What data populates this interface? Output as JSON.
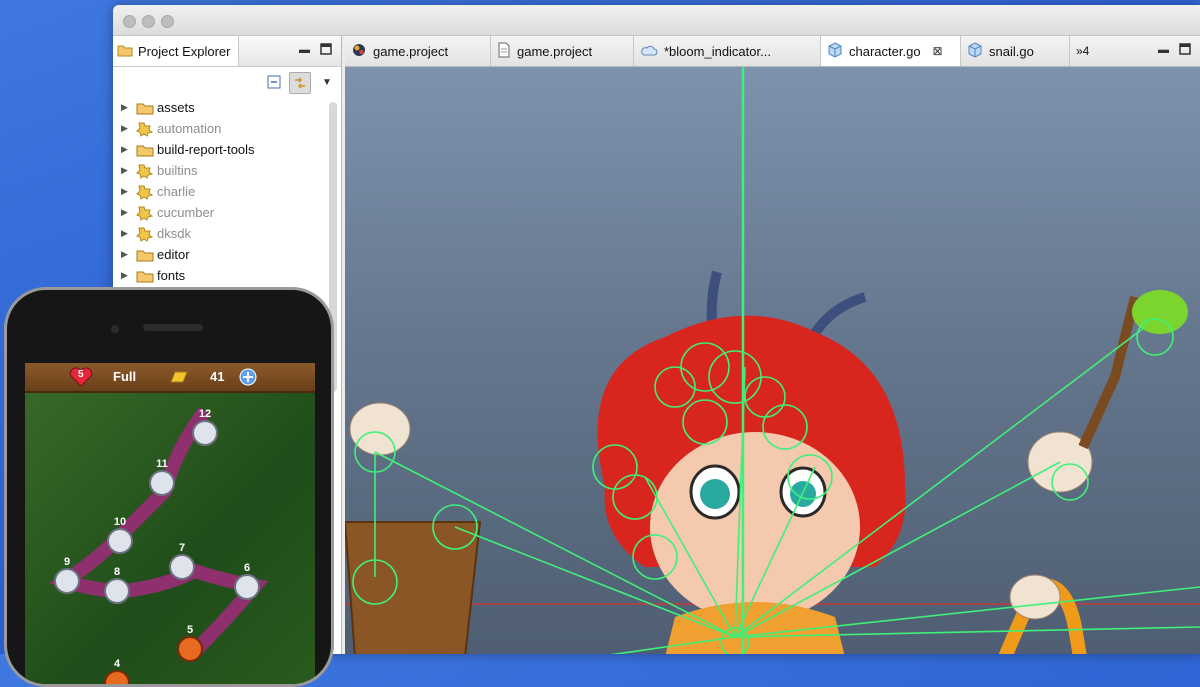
{
  "window": {
    "explorer": {
      "tab_label": "Project Explorer",
      "items": [
        {
          "label": "assets",
          "kind": "folder"
        },
        {
          "label": "automation",
          "kind": "library"
        },
        {
          "label": "build-report-tools",
          "kind": "folder"
        },
        {
          "label": "builtins",
          "kind": "library"
        },
        {
          "label": "charlie",
          "kind": "library"
        },
        {
          "label": "cucumber",
          "kind": "library"
        },
        {
          "label": "dksdk",
          "kind": "library"
        },
        {
          "label": "editor",
          "kind": "folder"
        },
        {
          "label": "fonts",
          "kind": "folder"
        }
      ]
    },
    "tabs": [
      {
        "label": "game.project",
        "icon": "defold-icon"
      },
      {
        "label": "game.project",
        "icon": "document-icon"
      },
      {
        "label": "*bloom_indicator...",
        "icon": "cloud-icon"
      },
      {
        "label": "character.go",
        "icon": "cube-icon"
      },
      {
        "label": "snail.go",
        "icon": "cube-icon"
      },
      {
        "label": "»4",
        "icon": ""
      }
    ],
    "active_tab": "character.go"
  },
  "phone": {
    "hud": {
      "lives": "5",
      "energy": "Full",
      "coins": "41"
    },
    "levels": [
      "12",
      "11",
      "10",
      "9",
      "8",
      "7",
      "6",
      "5",
      "4"
    ]
  },
  "colors": {
    "desktop": "#2f66d8",
    "bone": "#3ff07a",
    "hair": "#d8261e"
  }
}
